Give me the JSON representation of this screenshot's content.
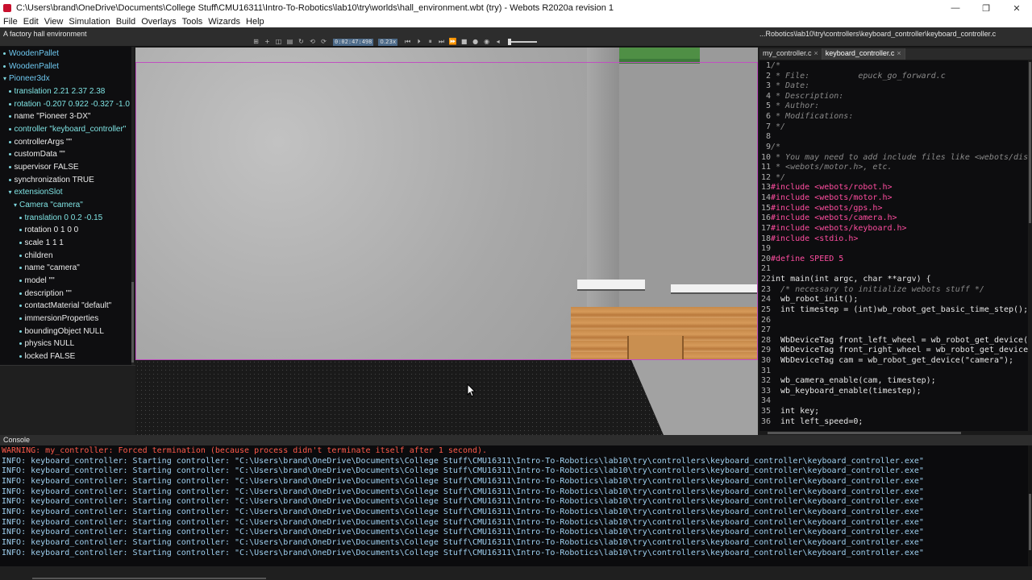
{
  "window": {
    "title": "C:\\Users\\brand\\OneDrive\\Documents\\College Stuff\\CMU16311\\Intro-To-Robotics\\lab10\\try\\worlds\\hall_environment.wbt (try) - Webots R2020a revision 1",
    "minimize": "—",
    "maximize": "❐",
    "close": "✕"
  },
  "menu": [
    "File",
    "Edit",
    "View",
    "Simulation",
    "Build",
    "Overlays",
    "Tools",
    "Wizards",
    "Help"
  ],
  "world_info": "A factory hall environment",
  "toolbar": {
    "sim_time": "0:02:47:498",
    "speed": "0.23x"
  },
  "scene_tree": [
    {
      "text": "WoodenPallet",
      "indent": 0,
      "marker": "bullet",
      "color": "blue"
    },
    {
      "text": "WoodenPallet",
      "indent": 0,
      "marker": "bullet",
      "color": "blue"
    },
    {
      "text": "Pioneer3dx",
      "indent": 0,
      "marker": "arrow",
      "color": "blue"
    },
    {
      "text": "translation 2.21 2.37 2.38",
      "indent": 1,
      "marker": "bullet",
      "color": "cyan"
    },
    {
      "text": "rotation -0.207 0.922 -0.327 -1.0",
      "indent": 1,
      "marker": "bullet",
      "color": "cyan"
    },
    {
      "text": "name \"Pioneer 3-DX\"",
      "indent": 1,
      "marker": "bullet",
      "color": "white"
    },
    {
      "text": "controller \"keyboard_controller\"",
      "indent": 1,
      "marker": "bullet",
      "color": "cyan"
    },
    {
      "text": "controllerArgs \"\"",
      "indent": 1,
      "marker": "bullet",
      "color": "white"
    },
    {
      "text": "customData \"\"",
      "indent": 1,
      "marker": "bullet",
      "color": "white"
    },
    {
      "text": "supervisor FALSE",
      "indent": 1,
      "marker": "bullet",
      "color": "white"
    },
    {
      "text": "synchronization TRUE",
      "indent": 1,
      "marker": "bullet",
      "color": "white"
    },
    {
      "text": "extensionSlot",
      "indent": 1,
      "marker": "arrow",
      "color": "cyan"
    },
    {
      "text": "Camera \"camera\"",
      "indent": 2,
      "marker": "arrow",
      "color": "cyan"
    },
    {
      "text": "translation 0 0.2 -0.15",
      "indent": 3,
      "marker": "bullet",
      "color": "cyan"
    },
    {
      "text": "rotation 0 1 0 0",
      "indent": 3,
      "marker": "bullet",
      "color": "white"
    },
    {
      "text": "scale 1 1 1",
      "indent": 3,
      "marker": "bullet",
      "color": "white"
    },
    {
      "text": "children",
      "indent": 3,
      "marker": "bullet",
      "color": "white"
    },
    {
      "text": "name \"camera\"",
      "indent": 3,
      "marker": "bullet",
      "color": "white"
    },
    {
      "text": "model \"\"",
      "indent": 3,
      "marker": "bullet",
      "color": "white"
    },
    {
      "text": "description \"\"",
      "indent": 3,
      "marker": "bullet",
      "color": "white"
    },
    {
      "text": "contactMaterial \"default\"",
      "indent": 3,
      "marker": "bullet",
      "color": "white"
    },
    {
      "text": "immersionProperties",
      "indent": 3,
      "marker": "bullet",
      "color": "white"
    },
    {
      "text": "boundingObject NULL",
      "indent": 3,
      "marker": "bullet",
      "color": "white"
    },
    {
      "text": "physics NULL",
      "indent": 3,
      "marker": "bullet",
      "color": "white"
    },
    {
      "text": "locked FALSE",
      "indent": 3,
      "marker": "bullet",
      "color": "white"
    }
  ],
  "editor": {
    "path": "...Robotics\\lab10\\try\\controllers\\keyboard_controller\\keyboard_controller.c",
    "tabs": [
      {
        "label": "my_controller.c",
        "active": false
      },
      {
        "label": "keyboard_controller.c",
        "active": true
      }
    ],
    "lines": [
      {
        "n": "1",
        "t": "/*",
        "k": "cm"
      },
      {
        "n": "2",
        "t": " * File:          epuck_go_forward.c",
        "k": "cm"
      },
      {
        "n": "3",
        "t": " * Date:",
        "k": "cm"
      },
      {
        "n": "4",
        "t": " * Description:",
        "k": "cm"
      },
      {
        "n": "5",
        "t": " * Author:",
        "k": "cm"
      },
      {
        "n": "6",
        "t": " * Modifications:",
        "k": "cm"
      },
      {
        "n": "7",
        "t": " */",
        "k": "cm"
      },
      {
        "n": "8",
        "t": "",
        "k": "tx"
      },
      {
        "n": "9",
        "t": "/*",
        "k": "cm"
      },
      {
        "n": "10",
        "t": " * You may need to add include files like <webots/dis",
        "k": "cm"
      },
      {
        "n": "11",
        "t": " * <webots/motor.h>, etc.",
        "k": "cm"
      },
      {
        "n": "12",
        "t": " */",
        "k": "cm"
      },
      {
        "n": "13",
        "t": "#include <webots/robot.h>",
        "k": "pp"
      },
      {
        "n": "14",
        "t": "#include <webots/motor.h>",
        "k": "pp"
      },
      {
        "n": "15",
        "t": "#include <webots/gps.h>",
        "k": "pp"
      },
      {
        "n": "16",
        "t": "#include <webots/camera.h>",
        "k": "pp"
      },
      {
        "n": "17",
        "t": "#include <webots/keyboard.h>",
        "k": "pp"
      },
      {
        "n": "18",
        "t": "#include <stdio.h>",
        "k": "pp"
      },
      {
        "n": "19",
        "t": "",
        "k": "tx"
      },
      {
        "n": "20",
        "t": "#define SPEED 5",
        "k": "pp"
      },
      {
        "n": "21",
        "t": "",
        "k": "tx"
      },
      {
        "n": "22",
        "t": "int main(int argc, char **argv) {",
        "k": "tx"
      },
      {
        "n": "23",
        "t": "  /* necessary to initialize webots stuff */",
        "k": "cm"
      },
      {
        "n": "24",
        "t": "  wb_robot_init();",
        "k": "tx"
      },
      {
        "n": "25",
        "t": "  int timestep = (int)wb_robot_get_basic_time_step();",
        "k": "tx"
      },
      {
        "n": "26",
        "t": "",
        "k": "tx"
      },
      {
        "n": "27",
        "t": "",
        "k": "tx"
      },
      {
        "n": "28",
        "t": "  WbDeviceTag front_left_wheel = wb_robot_get_device(\"",
        "k": "tx"
      },
      {
        "n": "29",
        "t": "  WbDeviceTag front_right_wheel = wb_robot_get_device",
        "k": "tx"
      },
      {
        "n": "30",
        "t": "  WbDeviceTag cam = wb_robot_get_device(\"camera\");",
        "k": "tx"
      },
      {
        "n": "31",
        "t": "",
        "k": "tx"
      },
      {
        "n": "32",
        "t": "  wb_camera_enable(cam, timestep);",
        "k": "tx"
      },
      {
        "n": "33",
        "t": "  wb_keyboard_enable(timestep);",
        "k": "tx"
      },
      {
        "n": "34",
        "t": "",
        "k": "tx"
      },
      {
        "n": "35",
        "t": "  int key;",
        "k": "tx"
      },
      {
        "n": "36",
        "t": "  int left_speed=0;",
        "k": "tx"
      }
    ]
  },
  "console": {
    "title": "Console",
    "lines": [
      {
        "k": "warn",
        "t": "WARNING: my_controller: Forced termination (because process didn't terminate itself after 1 second)."
      },
      {
        "k": "info",
        "t": "INFO: keyboard_controller: Starting controller: \"C:\\Users\\brand\\OneDrive\\Documents\\College Stuff\\CMU16311\\Intro-To-Robotics\\lab10\\try\\controllers\\keyboard_controller\\keyboard_controller.exe\""
      },
      {
        "k": "info",
        "t": "INFO: keyboard_controller: Starting controller: \"C:\\Users\\brand\\OneDrive\\Documents\\College Stuff\\CMU16311\\Intro-To-Robotics\\lab10\\try\\controllers\\keyboard_controller\\keyboard_controller.exe\""
      },
      {
        "k": "info",
        "t": "INFO: keyboard_controller: Starting controller: \"C:\\Users\\brand\\OneDrive\\Documents\\College Stuff\\CMU16311\\Intro-To-Robotics\\lab10\\try\\controllers\\keyboard_controller\\keyboard_controller.exe\""
      },
      {
        "k": "info",
        "t": "INFO: keyboard_controller: Starting controller: \"C:\\Users\\brand\\OneDrive\\Documents\\College Stuff\\CMU16311\\Intro-To-Robotics\\lab10\\try\\controllers\\keyboard_controller\\keyboard_controller.exe\""
      },
      {
        "k": "info",
        "t": "INFO: keyboard_controller: Starting controller: \"C:\\Users\\brand\\OneDrive\\Documents\\College Stuff\\CMU16311\\Intro-To-Robotics\\lab10\\try\\controllers\\keyboard_controller\\keyboard_controller.exe\""
      },
      {
        "k": "info",
        "t": "INFO: keyboard_controller: Starting controller: \"C:\\Users\\brand\\OneDrive\\Documents\\College Stuff\\CMU16311\\Intro-To-Robotics\\lab10\\try\\controllers\\keyboard_controller\\keyboard_controller.exe\""
      },
      {
        "k": "info",
        "t": "INFO: keyboard_controller: Starting controller: \"C:\\Users\\brand\\OneDrive\\Documents\\College Stuff\\CMU16311\\Intro-To-Robotics\\lab10\\try\\controllers\\keyboard_controller\\keyboard_controller.exe\""
      },
      {
        "k": "info",
        "t": "INFO: keyboard_controller: Starting controller: \"C:\\Users\\brand\\OneDrive\\Documents\\College Stuff\\CMU16311\\Intro-To-Robotics\\lab10\\try\\controllers\\keyboard_controller\\keyboard_controller.exe\""
      },
      {
        "k": "info",
        "t": "INFO: keyboard_controller: Starting controller: \"C:\\Users\\brand\\OneDrive\\Documents\\College Stuff\\CMU16311\\Intro-To-Robotics\\lab10\\try\\controllers\\keyboard_controller\\keyboard_controller.exe\""
      },
      {
        "k": "info",
        "t": "INFO: keyboard_controller: Starting controller: \"C:\\Users\\brand\\OneDrive\\Documents\\College Stuff\\CMU16311\\Intro-To-Robotics\\lab10\\try\\controllers\\keyboard_controller\\keyboard_controller.exe\""
      }
    ]
  }
}
